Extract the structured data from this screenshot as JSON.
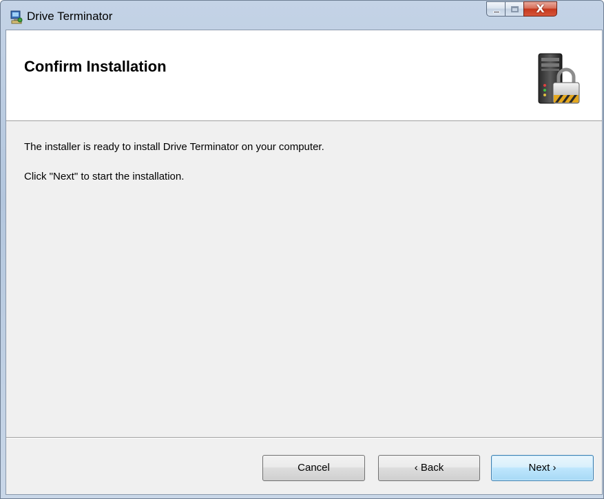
{
  "window": {
    "title": "Drive Terminator",
    "controls": {
      "close_glyph": "X"
    }
  },
  "banner": {
    "title": "Confirm Installation",
    "icon": "computer-padlock-icon"
  },
  "body": {
    "message_ready": "The installer is ready to install Drive Terminator on your computer.",
    "message_next": "Click \"Next\" to start the installation."
  },
  "buttons": {
    "cancel": "Cancel",
    "back": "‹ Back",
    "next": "Next ›"
  },
  "colors": {
    "client_bg": "#f0f0f0",
    "default_button": "#3c7fb1",
    "close_button": "#c5381d"
  }
}
